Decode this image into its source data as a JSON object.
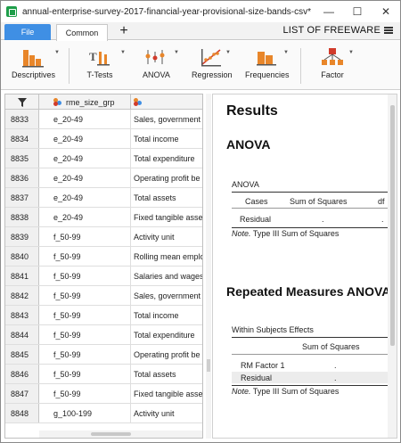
{
  "window": {
    "title": "annual-enterprise-survey-2017-financial-year-provisional-size-bands-csv*",
    "minimize": "—",
    "maximize": "☐",
    "close": "✕"
  },
  "tabs": {
    "file": "File",
    "common": "Common",
    "add": "+",
    "brand": "LIST OF FREEWARE"
  },
  "ribbon": {
    "descriptives": "Descriptives",
    "ttests": "T-Tests",
    "anova": "ANOVA",
    "regression": "Regression",
    "frequencies": "Frequencies",
    "factor": "Factor"
  },
  "grid": {
    "col1_header": "rme_size_grp",
    "col2_header": "",
    "rows": [
      {
        "num": "8833",
        "c1": "e_20-49",
        "c2": "Sales, government"
      },
      {
        "num": "8834",
        "c1": "e_20-49",
        "c2": "Total income"
      },
      {
        "num": "8835",
        "c1": "e_20-49",
        "c2": "Total expenditure"
      },
      {
        "num": "8836",
        "c1": "e_20-49",
        "c2": "Operating profit be"
      },
      {
        "num": "8837",
        "c1": "e_20-49",
        "c2": "Total assets"
      },
      {
        "num": "8838",
        "c1": "e_20-49",
        "c2": "Fixed tangible asse"
      },
      {
        "num": "8839",
        "c1": "f_50-99",
        "c2": "Activity unit"
      },
      {
        "num": "8840",
        "c1": "f_50-99",
        "c2": "Rolling mean emplo"
      },
      {
        "num": "8841",
        "c1": "f_50-99",
        "c2": "Salaries and wages"
      },
      {
        "num": "8842",
        "c1": "f_50-99",
        "c2": "Sales, government"
      },
      {
        "num": "8843",
        "c1": "f_50-99",
        "c2": "Total income"
      },
      {
        "num": "8844",
        "c1": "f_50-99",
        "c2": "Total expenditure"
      },
      {
        "num": "8845",
        "c1": "f_50-99",
        "c2": "Operating profit be"
      },
      {
        "num": "8846",
        "c1": "f_50-99",
        "c2": "Total assets"
      },
      {
        "num": "8847",
        "c1": "f_50-99",
        "c2": "Fixed tangible asse"
      },
      {
        "num": "8848",
        "c1": "g_100-199",
        "c2": "Activity unit"
      }
    ]
  },
  "results": {
    "title": "Results",
    "anova": {
      "heading": "ANOVA",
      "caption": "ANOVA",
      "col_cases": "Cases",
      "col_ss": "Sum of Squares",
      "col_df": "df",
      "row_residual": "Residual",
      "dot1": ".",
      "dot2": ".",
      "note_label": "Note.",
      "note_text": " Type III Sum of Squares"
    },
    "rm": {
      "heading": "Repeated Measures ANOVA",
      "caption": "Within Subjects Effects",
      "col_ss": "Sum of Squares",
      "row_factor": "RM Factor 1",
      "row_residual": "Residual",
      "dot1": ".",
      "dot2": ".",
      "note_label": "Note.",
      "note_text": " Type III Sum of Squares"
    }
  },
  "colors": {
    "file_tab": "#3f8fe4",
    "icon_orange": "#e8862a",
    "icon_red": "#d13b2b"
  }
}
